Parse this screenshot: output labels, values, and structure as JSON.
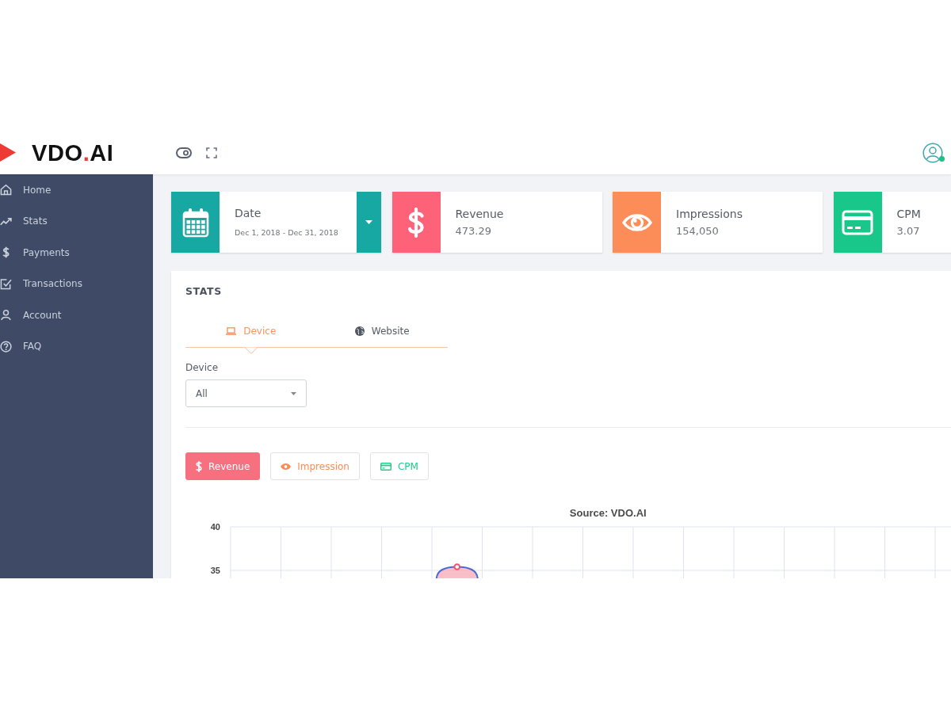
{
  "header": {
    "logo": {
      "parts": [
        {
          "text": "VDO",
          "accent": false
        },
        {
          "text": ".",
          "accent": true
        },
        {
          "text": "AI",
          "accent": false
        }
      ]
    },
    "user": {
      "online": true
    }
  },
  "sidebar": {
    "items": [
      {
        "label": "Home"
      },
      {
        "label": "Stats"
      },
      {
        "label": "Payments"
      },
      {
        "label": "Transactions"
      },
      {
        "label": "Account"
      },
      {
        "label": "FAQ"
      }
    ]
  },
  "cards": [
    {
      "kind": "picker",
      "title": "Date",
      "value": "Dec 1, 2018 - Dec 31, 2018",
      "color": "#17a8a3"
    },
    {
      "kind": "metric",
      "title": "Revenue",
      "value": "473.29",
      "color": "#fe6278"
    },
    {
      "kind": "metric",
      "title": "Impressions",
      "value": "154,050",
      "color": "#fd8d58"
    },
    {
      "kind": "metric",
      "title": "CPM",
      "value": "3.07",
      "color": "#19c78a"
    }
  ],
  "stats": {
    "title": "STATS",
    "tabs": [
      {
        "label": "Device",
        "selected": true
      },
      {
        "label": "Website",
        "selected": false
      }
    ],
    "filter": {
      "label": "Device",
      "value": "All"
    },
    "metric_buttons": [
      {
        "label": "Revenue",
        "selected": true,
        "color": "#f7707f"
      },
      {
        "label": "Impression",
        "selected": false,
        "color": "#f98c55"
      },
      {
        "label": "CPM",
        "selected": false,
        "color": "#1fc98a"
      }
    ],
    "chart_data": {
      "type": "area",
      "title": "Source: VDO.AI",
      "categories": [
        null,
        null,
        null,
        null,
        null,
        null,
        null,
        null,
        null,
        null,
        null,
        null,
        null,
        null,
        null
      ],
      "ylim": [
        34.1,
        40
      ],
      "yticks": [
        35,
        40
      ]
    }
  }
}
